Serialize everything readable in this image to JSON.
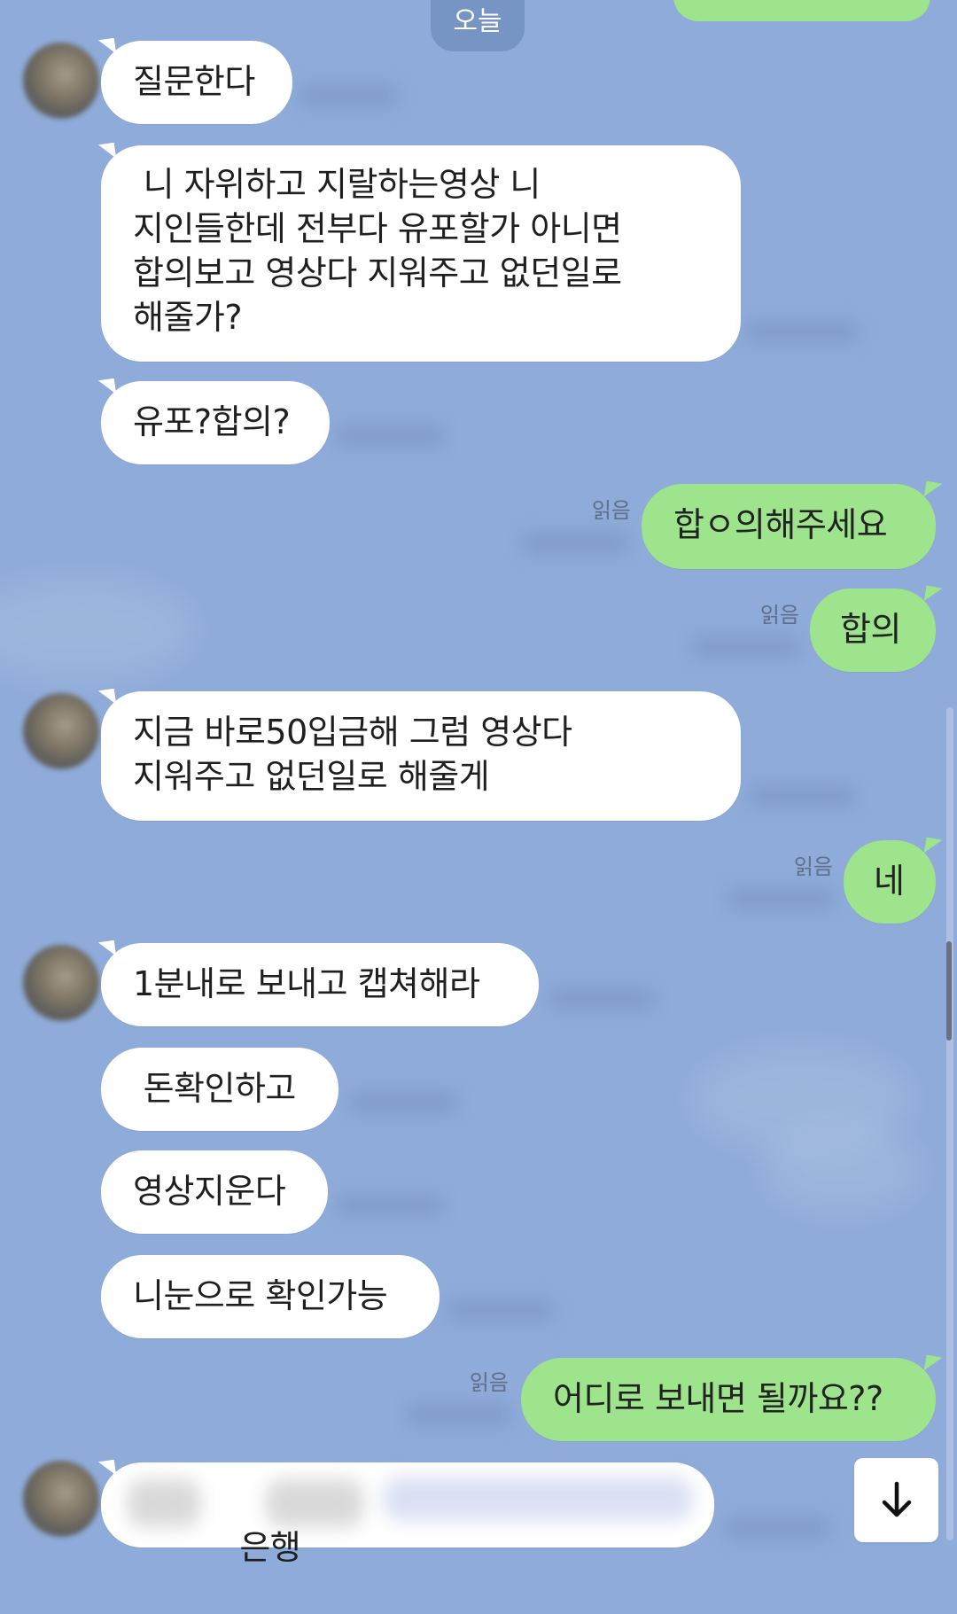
{
  "colors": {
    "background": "#8eabd9",
    "incoming_bubble": "#ffffff",
    "outgoing_bubble": "#9ee48c",
    "date_chip": "#7795c4",
    "read_label": "#5f6f8b"
  },
  "header": {
    "date_label": "오늘"
  },
  "messages": {
    "incoming_1": "질문한다",
    "incoming_2": " 니 자위하고 지랄하는영상 니\n지인들한데 전부다 유포할가 아니면\n합의보고 영상다 지워주고 없던일로\n해줄가?",
    "incoming_3": "유포?합의?",
    "outgoing_1": "합ㅇ의해주세요",
    "outgoing_2": "합의",
    "incoming_4": "지금 바로50입금해 그럼 영상다\n지워주고 없던일로 해줄게",
    "outgoing_3": "네",
    "incoming_5": "1분내로 보내고 캡쳐해라",
    "incoming_6": " 돈확인하고",
    "incoming_7": "영상지운다",
    "incoming_8": "니눈으로 확인가능",
    "outgoing_4": "어디로 보내면 될까요??",
    "incoming_9": "은행"
  },
  "read_receipts": {
    "r1": "읽음",
    "r2": "읽음",
    "r3": "읽음",
    "r4": "읽음"
  },
  "icons": {
    "scroll_down": "arrow-down-icon"
  }
}
